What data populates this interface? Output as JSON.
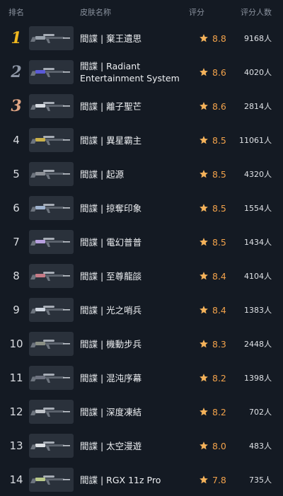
{
  "header": {
    "rank_label": "排名",
    "name_label": "皮肤名称",
    "rating_label": "评分",
    "count_label": "评分人数"
  },
  "rows": [
    {
      "rank": "1",
      "name": "間諜 | 棄王遺思",
      "rating": "8.8",
      "count": "9168人",
      "accent": "#9aa3ad"
    },
    {
      "rank": "2",
      "name": "間諜 | Radiant Entertainment System",
      "rating": "8.6",
      "count": "4020人",
      "accent": "#5a5ad8"
    },
    {
      "rank": "3",
      "name": "間諜 | 離子聖芒",
      "rating": "8.6",
      "count": "2814人",
      "accent": "#d8dce2"
    },
    {
      "rank": "4",
      "name": "間諜 | 異星霸主",
      "rating": "8.5",
      "count": "11061人",
      "accent": "#c9b04a"
    },
    {
      "rank": "5",
      "name": "間諜 | 起源",
      "rating": "8.5",
      "count": "4320人",
      "accent": "#8b8f96"
    },
    {
      "rank": "6",
      "name": "間諜 | 掠奪印象",
      "rating": "8.5",
      "count": "1554人",
      "accent": "#a0b4d0"
    },
    {
      "rank": "7",
      "name": "間諜 | 電幻普普",
      "rating": "8.5",
      "count": "1434人",
      "accent": "#b8a0e0"
    },
    {
      "rank": "8",
      "name": "間諜 | 至尊龍燄",
      "rating": "8.4",
      "count": "4104人",
      "accent": "#c77a86"
    },
    {
      "rank": "9",
      "name": "間諜 | 光之哨兵",
      "rating": "8.4",
      "count": "1383人",
      "accent": "#cfd6e0"
    },
    {
      "rank": "10",
      "name": "間諜 | 機動步兵",
      "rating": "8.3",
      "count": "2448人",
      "accent": "#8a8f85"
    },
    {
      "rank": "11",
      "name": "間諜 | 混沌序幕",
      "rating": "8.2",
      "count": "1398人",
      "accent": "#6e7380"
    },
    {
      "rank": "12",
      "name": "間諜 | 深度凍結",
      "rating": "8.2",
      "count": "702人",
      "accent": "#c0c4ca"
    },
    {
      "rank": "13",
      "name": "間諜 | 太空漫遊",
      "rating": "8.0",
      "count": "483人",
      "accent": "#dde0e4"
    },
    {
      "rank": "14",
      "name": "間諜 | RGX 11z Pro",
      "rating": "7.8",
      "count": "735人",
      "accent": "#b9c98a"
    }
  ],
  "colors": {
    "background": "#141a23",
    "gold": "#f0b81f",
    "silver": "#8e97a6",
    "bronze": "#e0a584",
    "rating": "#f2a24b",
    "star": "#f4b25a"
  },
  "icons": {
    "star": "star-icon",
    "thumbnail": "sniper-rifle-skin-thumbnail"
  }
}
